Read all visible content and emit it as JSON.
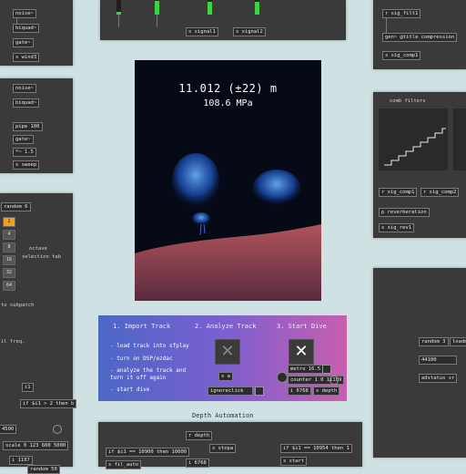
{
  "top_panel": {
    "signal_objects": [
      "s signal1",
      "s signal2"
    ],
    "meter_levels": [
      0.2,
      0.95,
      0.9,
      0.9
    ]
  },
  "left_top_panel": {
    "objects": [
      "noise~",
      "biquad~",
      "gate~",
      "s wind3"
    ]
  },
  "left_mid_panel": {
    "objects": [
      "noise~",
      "biquad~",
      "pipe 100",
      "gate~",
      "*~ 1.5",
      "s sweep"
    ]
  },
  "left_bottom_panel": {
    "objects": [
      "random 6",
      "i1",
      "if $i1 > 2 then b",
      "4500",
      "scale 0 123 600 5000",
      "i 1107",
      "random 50"
    ],
    "tabs": [
      "2",
      "4",
      "8",
      "16",
      "32",
      "64"
    ],
    "comments": [
      "octave",
      "selection tab",
      "to subpatch",
      "il freq."
    ]
  },
  "right_top_panel": {
    "objects": [
      "r sig_filt1",
      "gen~ @title compression",
      "s sig_comp1"
    ]
  },
  "comb_panel": {
    "title": "comb filters",
    "objects": [
      "r sig_comp1",
      "r sig_comp2",
      "p reverberation",
      "s sig_rev1"
    ]
  },
  "right_bottom_panel": {
    "objects": [
      "random 3",
      "loadm",
      "44100",
      "adstatus sr"
    ]
  },
  "video": {
    "depth": "11.012 (±22) m",
    "pressure": "108.6 MPa"
  },
  "steps": {
    "headers": [
      "1. Import Track",
      "2. Analyze Track",
      "3. Start Dive"
    ],
    "items": [
      "- load track into sfplay",
      "- turn on DSP/ezdac",
      "- analyze the track and",
      "  turn it off again",
      "- start dive"
    ],
    "x_glyph": "✕",
    "objects": [
      "s a",
      "ignoreclick",
      "metro 16.5",
      "counter 1 0 11109",
      "i 6768",
      "s depth"
    ]
  },
  "automation": {
    "title": "Depth Automation",
    "objects": [
      "r depth",
      "s stopa",
      "if $i1 == 10900 then 10000",
      "if $i1 == 10954 then 1",
      "s start",
      "i 6768",
      "s fil_auto"
    ]
  },
  "colors": {
    "background": "#cfe1e2",
    "panel": "#3a3a3a",
    "meter": "#3fd33f",
    "tab_active": "#f0a020"
  }
}
